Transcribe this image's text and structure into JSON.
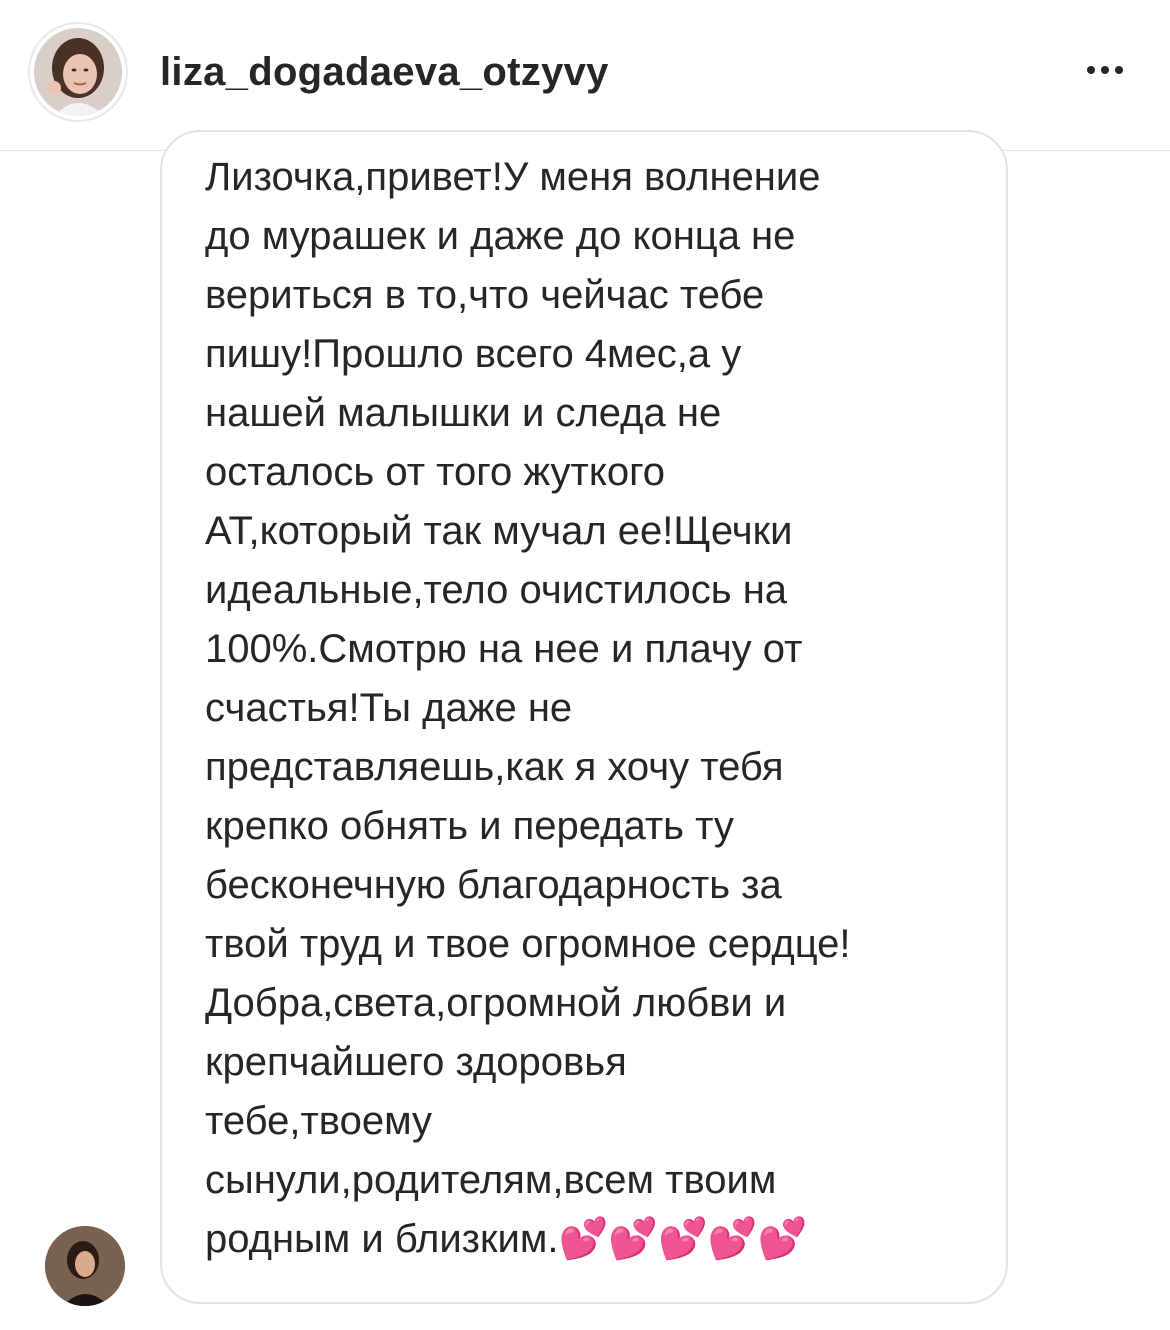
{
  "header": {
    "username": "liza_dogadaeva_otzyvy",
    "more_icon": "more-horizontal-icon"
  },
  "message": {
    "text": "Лизочка,привет!У меня волнение\nдо мурашек и даже до конца не\nвериться в то,что чейчас тебе\nпишу!Прошло всего 4мес,а у\nнашей малышки и следа не\nосталось от того жуткого\nАТ,который так мучал ее!Щечки\nидеальные,тело очистилось на\n100%.Смотрю на нее и плачу от\nсчастья!Ты даже не\nпредставляешь,как я хочу тебя\nкрепко обнять и передать ту\nбесконечную благодарность за\nтвой труд и твое огромное сердце!\nДобра,света,огромной любви и\nкрепчайшего здоровья\nтебе,твоему\nсынули,родителям,всем твоим\nродным и близким.",
    "emoji": "💕💕💕💕💕"
  },
  "colors": {
    "text": "#262626",
    "bubble_border": "#e2e2e2",
    "divider": "#e6e6e6",
    "hearts": "#e8349c"
  }
}
